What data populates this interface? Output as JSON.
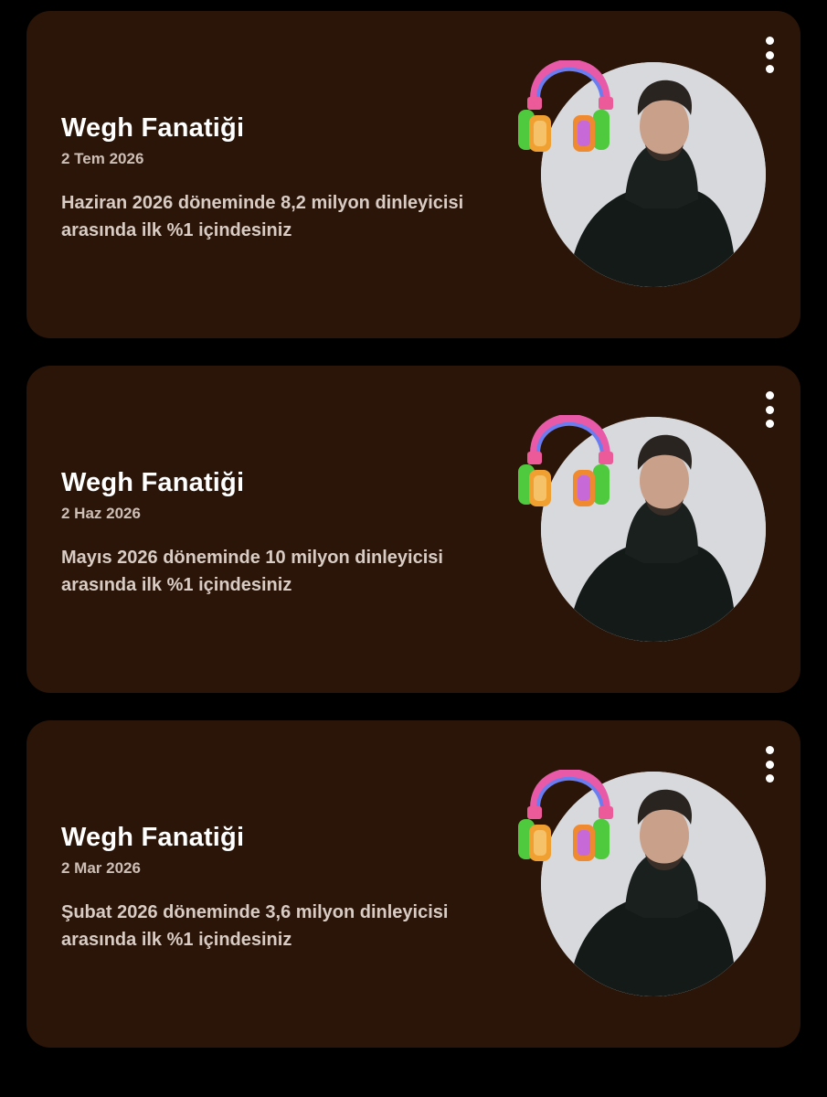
{
  "cards": [
    {
      "title": "Wegh Fanatiği",
      "date": "2 Tem 2026",
      "description": "Haziran 2026 döneminde 8,2 milyon dinleyicisi arasında ilk %1 içindesiniz",
      "image": "artist-avatar",
      "badge_icon": "headphones-icon"
    },
    {
      "title": "Wegh Fanatiği",
      "date": "2 Haz 2026",
      "description": "Mayıs 2026 döneminde 10 milyon dinleyicisi arasında ilk %1 içindesiniz",
      "image": "artist-avatar",
      "badge_icon": "headphones-icon"
    },
    {
      "title": "Wegh Fanatiği",
      "date": "2 Mar 2026",
      "description": "Şubat 2026 döneminde 3,6 milyon dinleyicisi arasında ilk %1 içindesiniz",
      "image": "artist-avatar",
      "badge_icon": "headphones-icon"
    }
  ],
  "menu_icon": "more-vertical-icon",
  "colors": {
    "page_background": "#000000",
    "card_background": "#2b1508",
    "title": "#ffffff",
    "secondary_text": "#d8ccc4"
  }
}
